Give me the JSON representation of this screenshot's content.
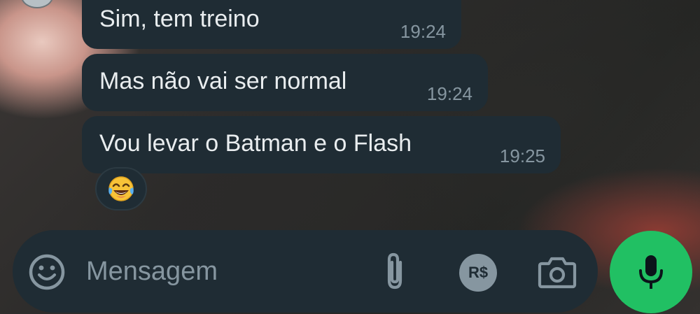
{
  "messages": [
    {
      "text": "Sim, tem treino",
      "time": "19:24"
    },
    {
      "text": "Mas não vai ser normal",
      "time": "19:24"
    },
    {
      "text": "Vou levar o Batman e o Flash",
      "time": "19:25"
    }
  ],
  "reaction": {
    "emoji": "😂",
    "icon": "tears-of-joy-emoji"
  },
  "composer": {
    "placeholder": "Mensagem",
    "emoji_icon": "smiley-icon",
    "attach_icon": "paperclip-icon",
    "pay_icon": "payment-icon",
    "pay_label": "R$",
    "camera_icon": "camera-icon",
    "send_icon": "microphone-icon"
  },
  "colors": {
    "bubble": "#1f2c34",
    "text": "#e9edef",
    "timestamp": "#8696a0",
    "accent": "#21c063"
  }
}
